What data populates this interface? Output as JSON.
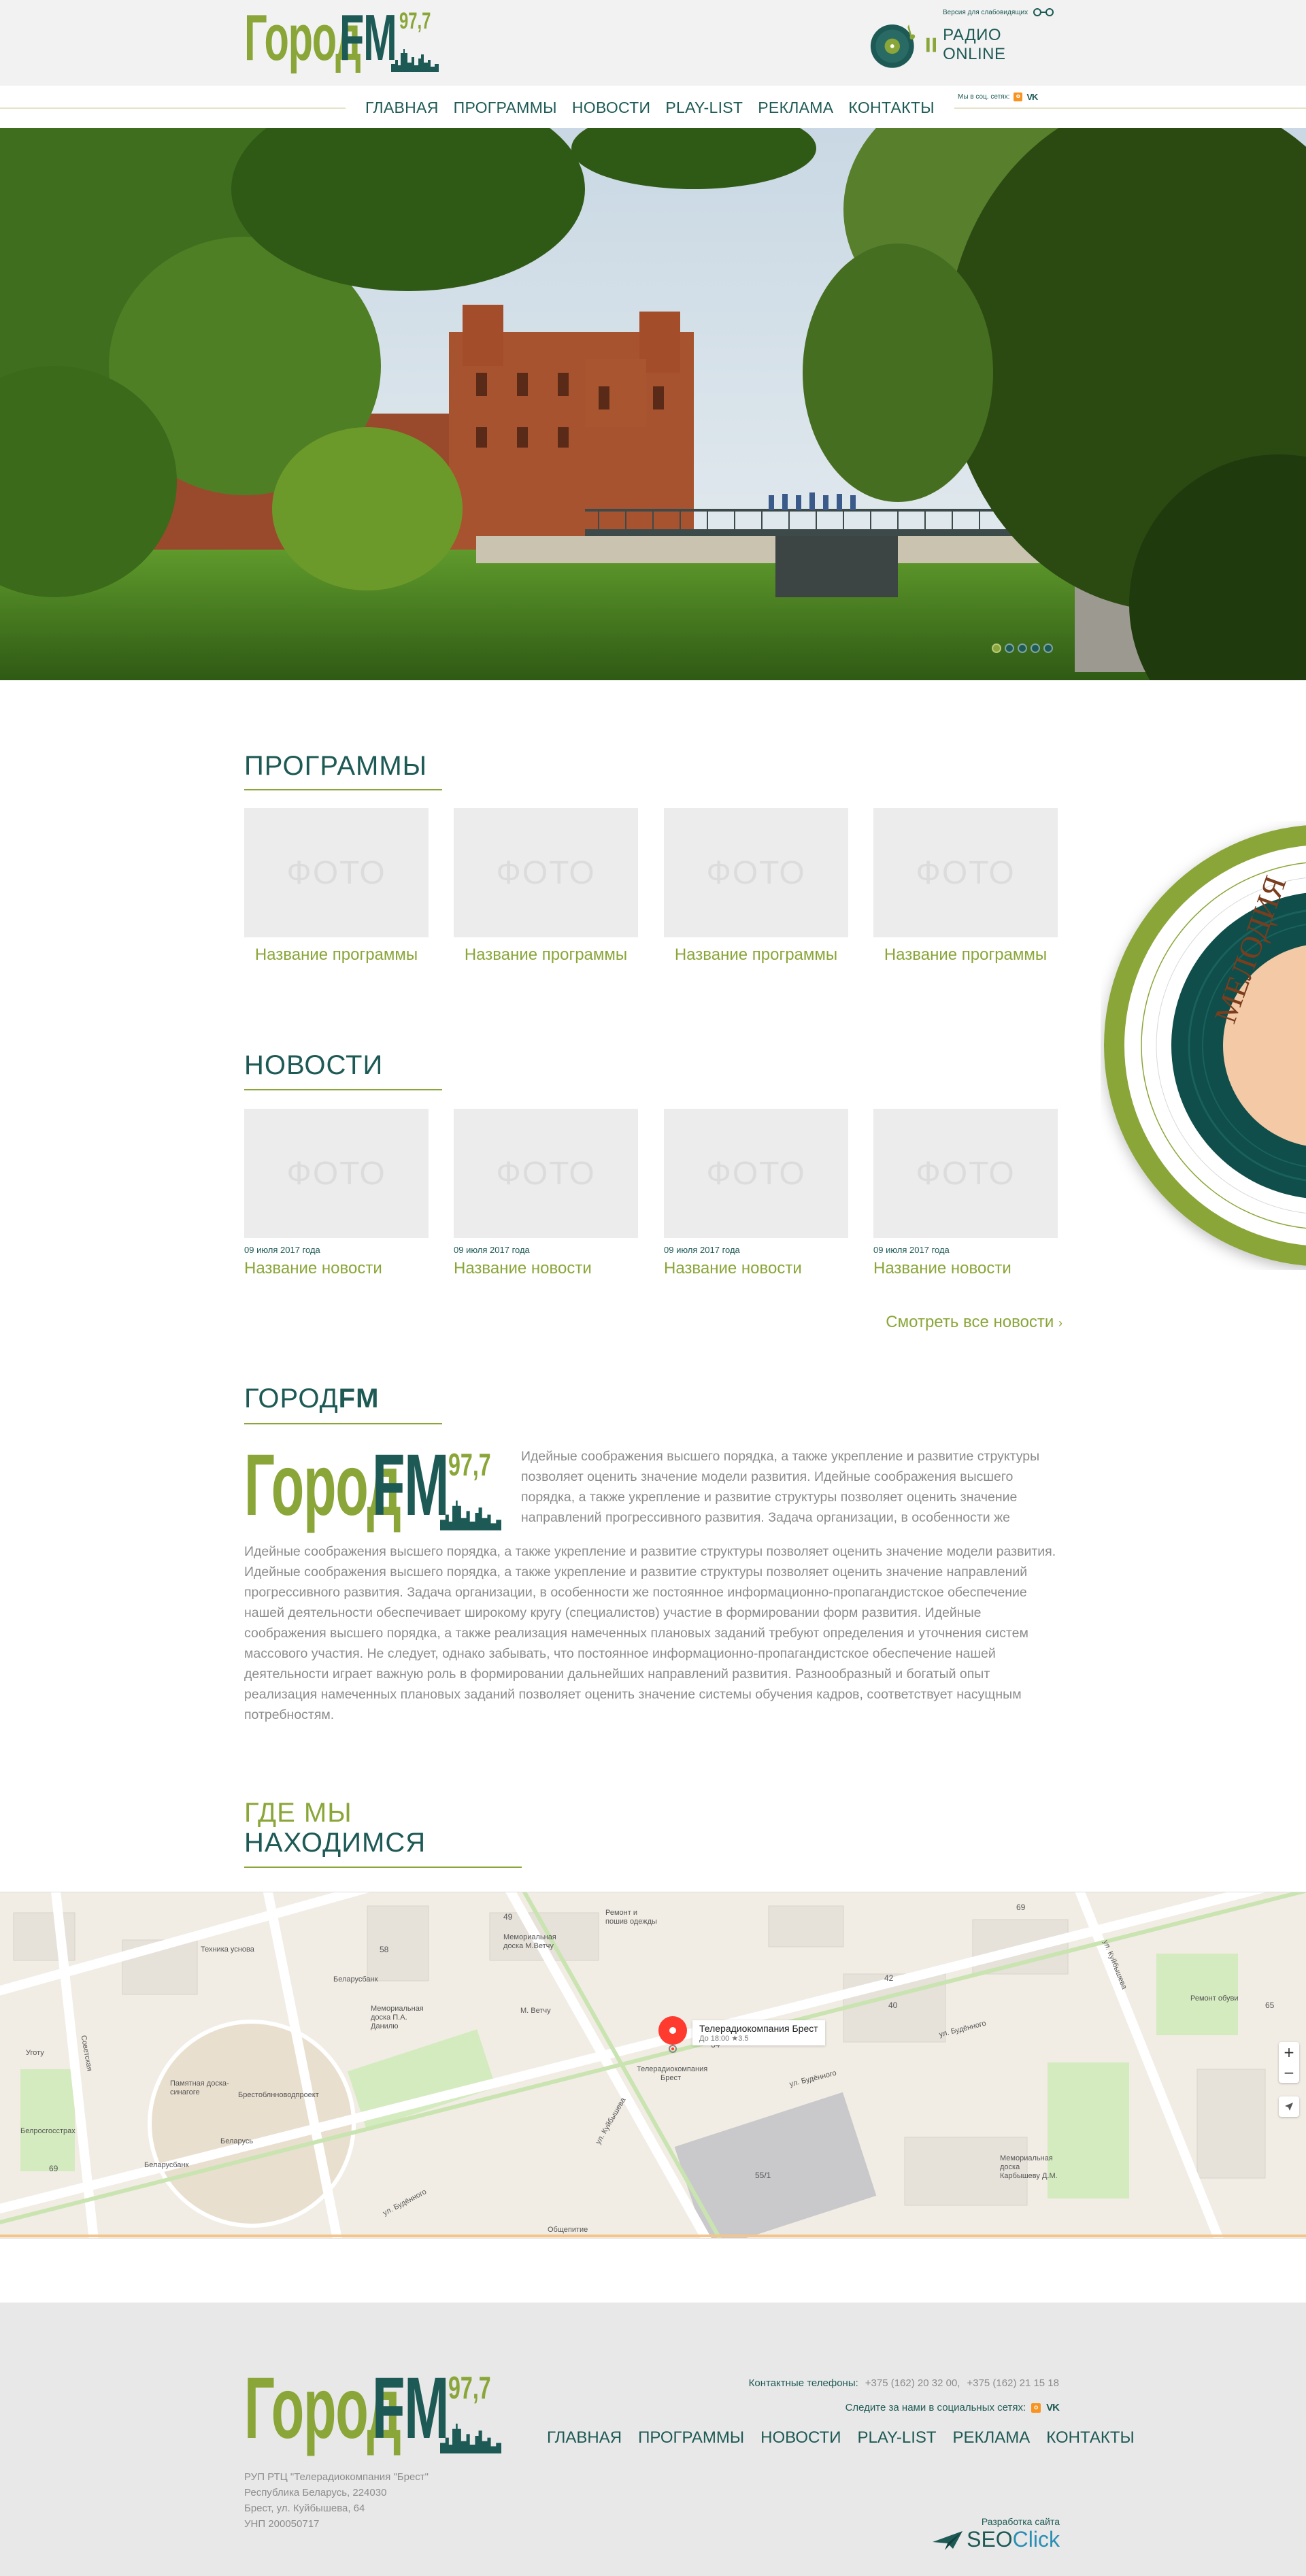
{
  "header": {
    "logo_word1": "Город",
    "logo_word2": "FM",
    "logo_freq": "97,7",
    "accessibility_label": "Версия для слабовидящих",
    "radio_online_label": "РАДИО ONLINE"
  },
  "nav": {
    "items": [
      "ГЛАВНАЯ",
      "ПРОГРАММЫ",
      "НОВОСТИ",
      "PLAY-LIST",
      "РЕКЛАМА",
      "КОНТАКТЫ"
    ],
    "social_label": "Мы в соц. сетях:"
  },
  "hero": {
    "slide_count": 5,
    "active_slide": 1
  },
  "programs": {
    "title": "ПРОГРАММЫ",
    "items": [
      {
        "photo": "ФОТО",
        "name": "Название программы"
      },
      {
        "photo": "ФОТО",
        "name": "Название программы"
      },
      {
        "photo": "ФОТО",
        "name": "Название программы"
      },
      {
        "photo": "ФОТО",
        "name": "Название программы"
      }
    ]
  },
  "news": {
    "title": "НОВОСТИ",
    "items": [
      {
        "photo": "ФОТО",
        "date": "09 июля 2017 года",
        "name": "Название новости"
      },
      {
        "photo": "ФОТО",
        "date": "09 июля 2017 года",
        "name": "Название новости"
      },
      {
        "photo": "ФОТО",
        "date": "09 июля 2017 года",
        "name": "Название новости"
      },
      {
        "photo": "ФОТО",
        "date": "09 июля 2017 года",
        "name": "Название новости"
      }
    ],
    "see_all": "Смотреть все новости"
  },
  "vinyl": {
    "label_text": "МЕЛОДИЯ"
  },
  "about": {
    "title_part1": "ГОРОД",
    "title_part2": "FM",
    "intro": "Идейные соображения высшего порядка, а также укрепление и развитие структуры позволяет оценить значение модели развития. Идейные соображения высшего порядка, а также укрепление и развитие структуры позволяет оценить значение направлений прогрессивного развития. Задача организации, в особенности же",
    "body": "Идейные соображения высшего порядка, а также укрепление и развитие структуры позволяет оценить значение модели развития. Идейные соображения высшего порядка, а также укрепление и развитие структуры позволяет оценить значение направлений прогрессивного развития. Задача организации, в особенности же постоянное информационно-пропагандистское обеспечение нашей деятельности обеспечивает широкому кругу (специалистов) участие в формировании форм развития. Идейные соображения высшего порядка, а также реализация намеченных плановых заданий требуют определения и уточнения систем массового участия. Не следует, однако забывать, что постоянное информационно-пропагандистское обеспечение нашей деятельности играет важную роль в формировании дальнейших направлений развития. Разнообразный и богатый опыт реализация намеченных плановых заданий позволяет оценить значение системы обучения кадров, соответствует насущным потребностям."
  },
  "location": {
    "title_line1": "ГДЕ МЫ",
    "title_line2": "НАХОДИМСЯ"
  },
  "map": {
    "pin_title": "Телерадиокомпания Брест",
    "pin_hours": "До 18:00",
    "pin_rating": "3.5",
    "pin_sub": "Телерадиокомпания Брест",
    "labels": [
      "Техника уснова",
      "Беларусбанк",
      "Мемориальная доска П.А. Данилю",
      "Мемориальная доска М.Ветчу",
      "М. Ветчу",
      "Ремонт и пошив одежды",
      "Памятная доска-синагоге",
      "Брестоблнноводпроект",
      "Беларусь",
      "Беларусбанк",
      "Белросгосстрах",
      "Общепитие",
      "Мемориальная доска Карбышеву Д.М.",
      "Ремонт обуви",
      "ул. Будённого",
      "ул. Будённого",
      "ул. Будённого",
      "ул. Куйбышева",
      "ул. Куйбышева",
      "Советская",
      "Уготу"
    ],
    "numbers": [
      "49",
      "58",
      "40",
      "55/1",
      "64",
      "69",
      "42",
      "65",
      "69"
    ]
  },
  "footer": {
    "phones_label": "Контактные телефоны:",
    "phone1": "+375 (162) 20 32 00,",
    "phone2": "+375 (162) 21 15 18",
    "social_label": "Следите за нами в социальных сетях:",
    "nav": [
      "ГЛАВНАЯ",
      "ПРОГРАММЫ",
      "НОВОСТИ",
      "PLAY-LIST",
      "РЕКЛАМА",
      "КОНТАКТЫ"
    ],
    "address": [
      "РУП РТЦ \"Телерадиокомпания \"Брест\"",
      "Республика Беларусь, 224030",
      "Брест, ул. Куйбышева, 64",
      "УНП 200050717"
    ],
    "dev_label": "Разработка сайта",
    "dev_name1": "SEO",
    "dev_name2": "Click"
  },
  "colors": {
    "green": "#8aa638",
    "teal": "#1d5a55",
    "ok": "#f7931e",
    "vk": "#1d5a55"
  }
}
